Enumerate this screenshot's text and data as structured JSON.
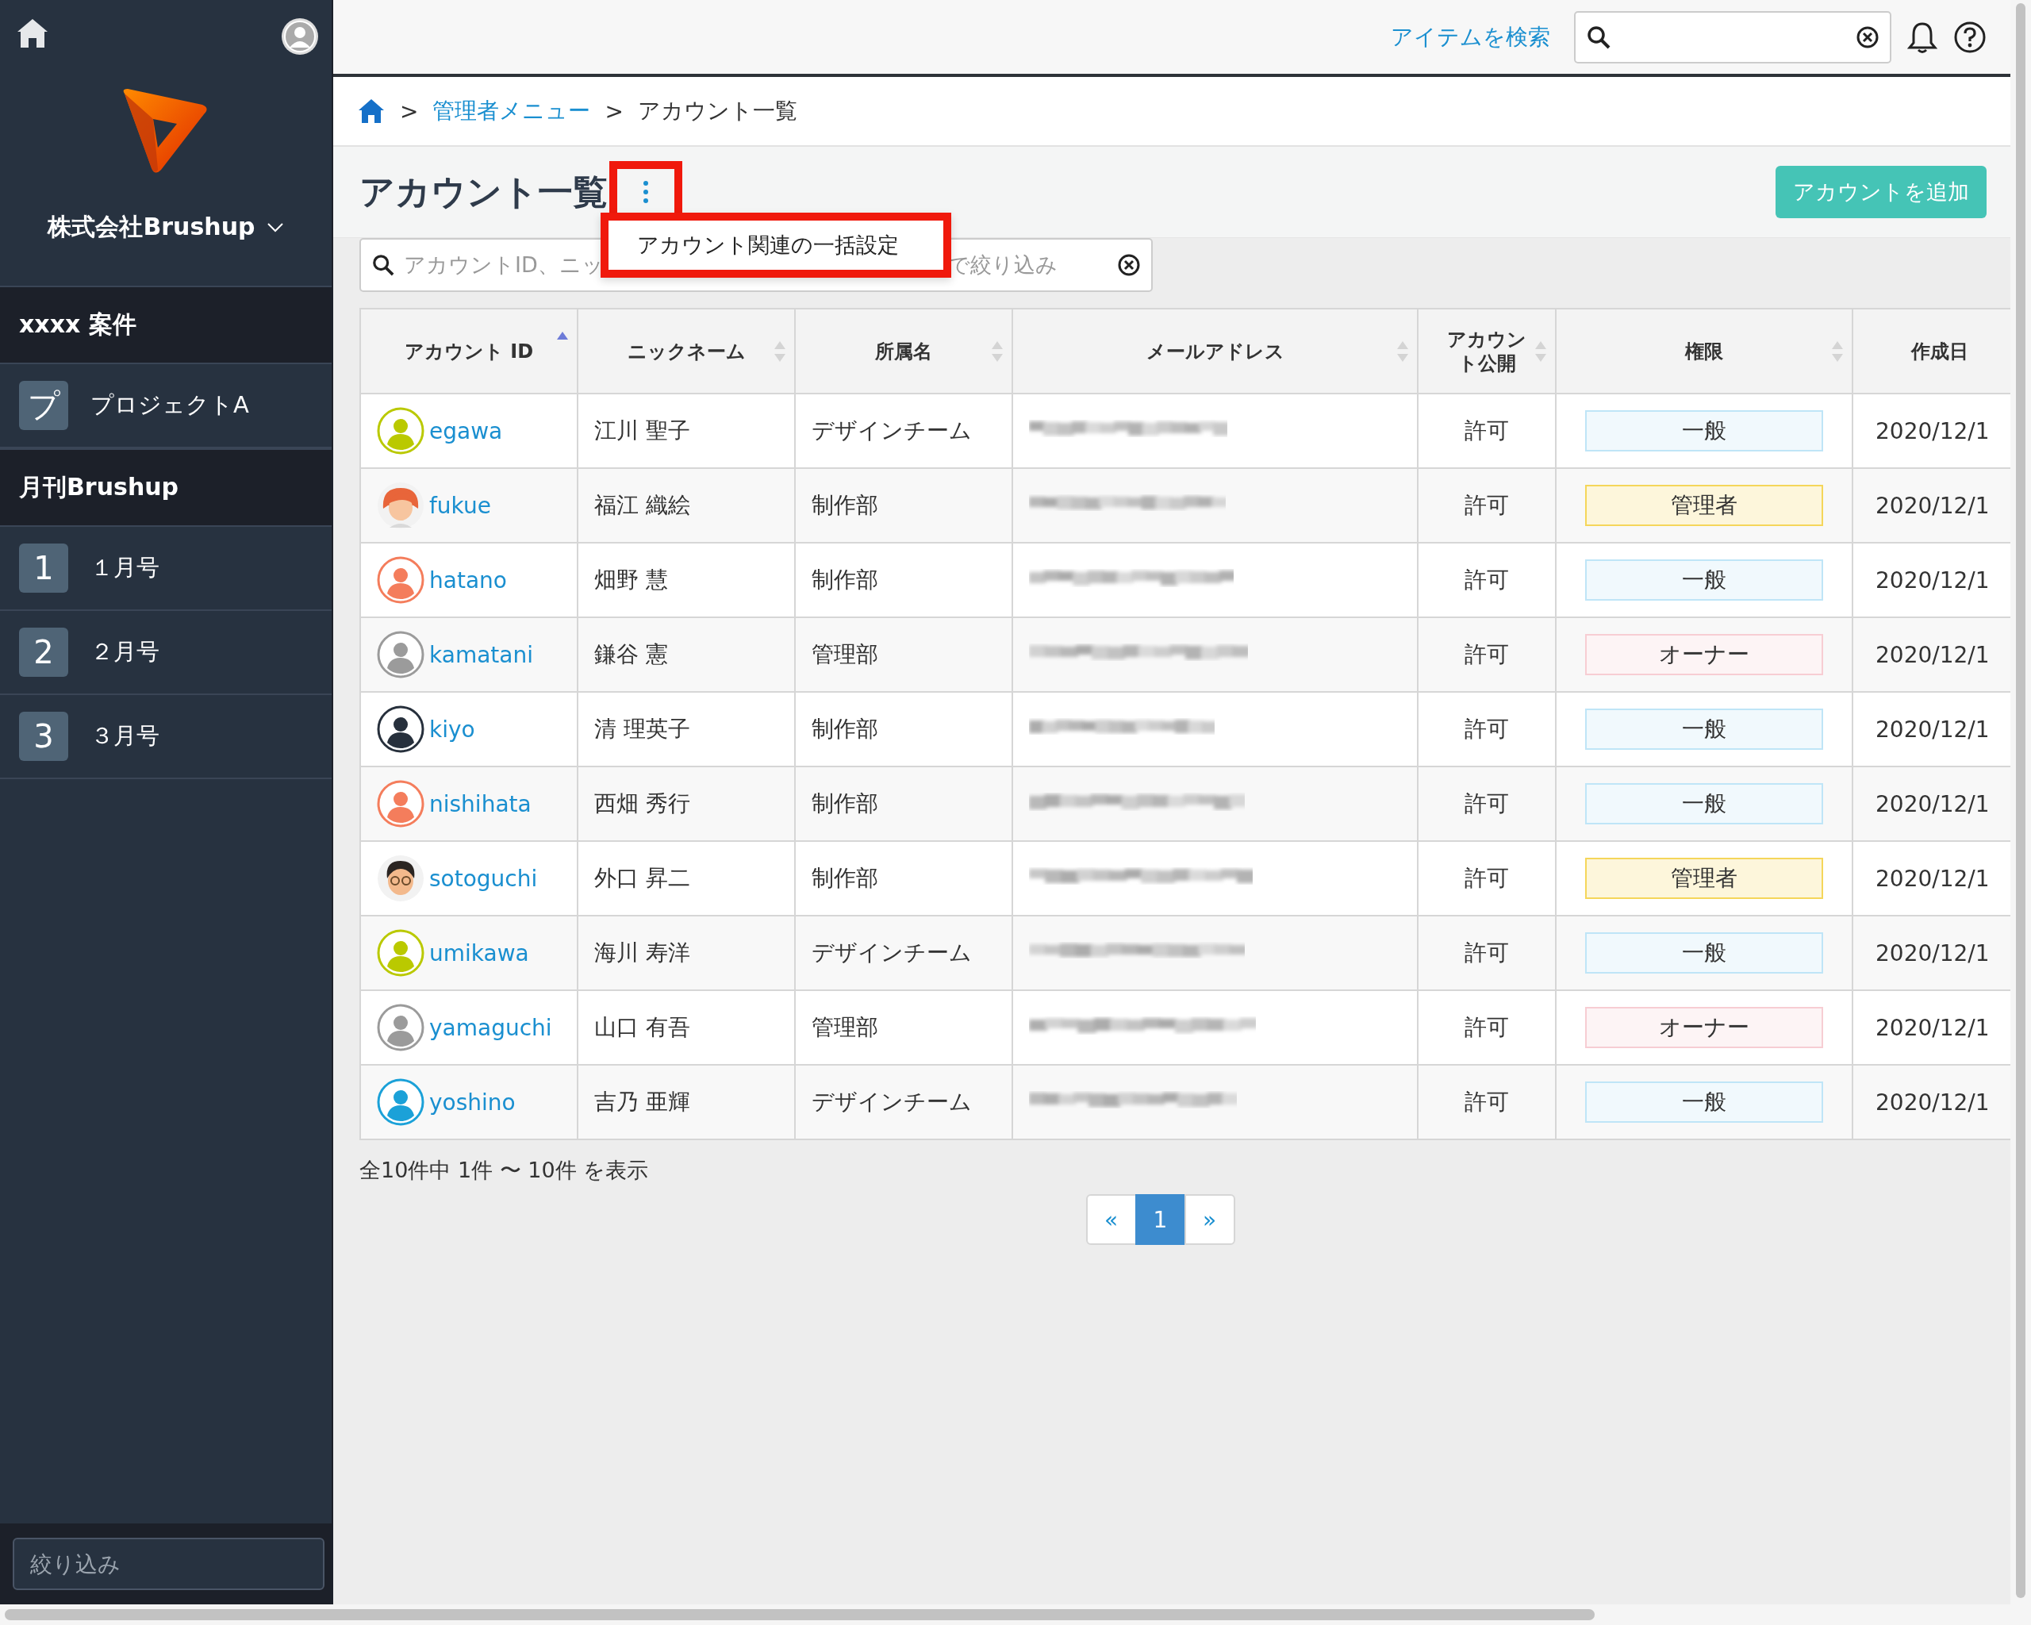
{
  "sidebar": {
    "company": "株式会社Brushup",
    "sections": [
      {
        "title": "xxxx 案件",
        "items": [
          {
            "badge": "プ",
            "label": "プロジェクトA"
          }
        ]
      },
      {
        "title": "月刊Brushup",
        "items": [
          {
            "badge": "1",
            "label": "１月号"
          },
          {
            "badge": "2",
            "label": "２月号"
          },
          {
            "badge": "3",
            "label": "３月号"
          }
        ]
      }
    ],
    "filter": {
      "placeholder": "絞り込み"
    }
  },
  "topbar": {
    "search_label": "アイテムを検索"
  },
  "breadcrumb": [
    {
      "kind": "home"
    },
    {
      "kind": "separator",
      "text": ">"
    },
    {
      "kind": "link",
      "text": "管理者メニュー"
    },
    {
      "kind": "separator",
      "text": ">"
    },
    {
      "kind": "current",
      "text": "アカウント一覧"
    }
  ],
  "page": {
    "title": "アカウント一覧",
    "menu": {
      "open": true,
      "items": [
        "アカウント関連の一括設定"
      ]
    },
    "add_button": "アカウントを追加"
  },
  "filter": {
    "placeholder": "アカウントID、ニッ",
    "placeholder_end": "で絞り込み"
  },
  "table": {
    "columns": [
      {
        "label": "アカウント ID",
        "sorted": true
      },
      {
        "label": "ニックネーム",
        "sorted": false
      },
      {
        "label": "所属名",
        "sorted": false
      },
      {
        "label": "メールアドレス",
        "sorted": false
      },
      {
        "label": "アカウント公開",
        "sorted": false
      },
      {
        "label": "権限",
        "sorted": false
      },
      {
        "label": "作成日"
      }
    ],
    "rows": [
      {
        "avatar": {
          "kind": "silhouette",
          "color": "#bac900"
        },
        "account_id": "egawa",
        "nickname": "江川 聖子",
        "department": "デザインチーム",
        "public": "許可",
        "role": {
          "label": "一般",
          "color": "#bfe5f7"
        },
        "created": "2020/12/1"
      },
      {
        "avatar": {
          "kind": "cartoon-woman"
        },
        "account_id": "fukue",
        "nickname": "福江 織絵",
        "department": "制作部",
        "public": "許可",
        "role": {
          "label": "管理者",
          "color": "#f5d65a"
        },
        "created": "2020/12/1"
      },
      {
        "avatar": {
          "kind": "silhouette",
          "color": "#f47d5c"
        },
        "account_id": "hatano",
        "nickname": "畑野 慧",
        "department": "制作部",
        "public": "許可",
        "role": {
          "label": "一般",
          "color": "#bfe5f7"
        },
        "created": "2020/12/1"
      },
      {
        "avatar": {
          "kind": "silhouette",
          "color": "#9b9b9b"
        },
        "account_id": "kamatani",
        "nickname": "鎌谷 憲",
        "department": "管理部",
        "public": "許可",
        "role": {
          "label": "オーナー",
          "color": "#f7cdd3"
        },
        "created": "2020/12/1"
      },
      {
        "avatar": {
          "kind": "silhouette",
          "color": "#27303c"
        },
        "account_id": "kiyo",
        "nickname": "清 理英子",
        "department": "制作部",
        "public": "許可",
        "role": {
          "label": "一般",
          "color": "#bfe5f7"
        },
        "created": "2020/12/1"
      },
      {
        "avatar": {
          "kind": "silhouette",
          "color": "#f47d5c"
        },
        "account_id": "nishihata",
        "nickname": "西畑 秀行",
        "department": "制作部",
        "public": "許可",
        "role": {
          "label": "一般",
          "color": "#bfe5f7"
        },
        "created": "2020/12/1"
      },
      {
        "avatar": {
          "kind": "cartoon-man"
        },
        "account_id": "sotoguchi",
        "nickname": "外口 昇二",
        "department": "制作部",
        "public": "許可",
        "role": {
          "label": "管理者",
          "color": "#f5d65a"
        },
        "created": "2020/12/1"
      },
      {
        "avatar": {
          "kind": "silhouette",
          "color": "#bac900"
        },
        "account_id": "umikawa",
        "nickname": "海川 寿洋",
        "department": "デザインチーム",
        "public": "許可",
        "role": {
          "label": "一般",
          "color": "#bfe5f7"
        },
        "created": "2020/12/1"
      },
      {
        "avatar": {
          "kind": "silhouette",
          "color": "#9b9b9b"
        },
        "account_id": "yamaguchi",
        "nickname": "山口 有吾",
        "department": "管理部",
        "public": "許可",
        "role": {
          "label": "オーナー",
          "color": "#f7cdd3"
        },
        "created": "2020/12/1"
      },
      {
        "avatar": {
          "kind": "silhouette",
          "color": "#1ba1d8"
        },
        "account_id": "yoshino",
        "nickname": "吉乃 亜輝",
        "department": "デザインチーム",
        "public": "許可",
        "role": {
          "label": "一般",
          "color": "#bfe5f7"
        },
        "created": "2020/12/1"
      }
    ]
  },
  "summary": "全10件中 1件 〜 10件 を表示",
  "pagination": [
    {
      "label": "«",
      "selected": false
    },
    {
      "label": "1",
      "selected": true
    },
    {
      "label": "»",
      "selected": false
    }
  ]
}
